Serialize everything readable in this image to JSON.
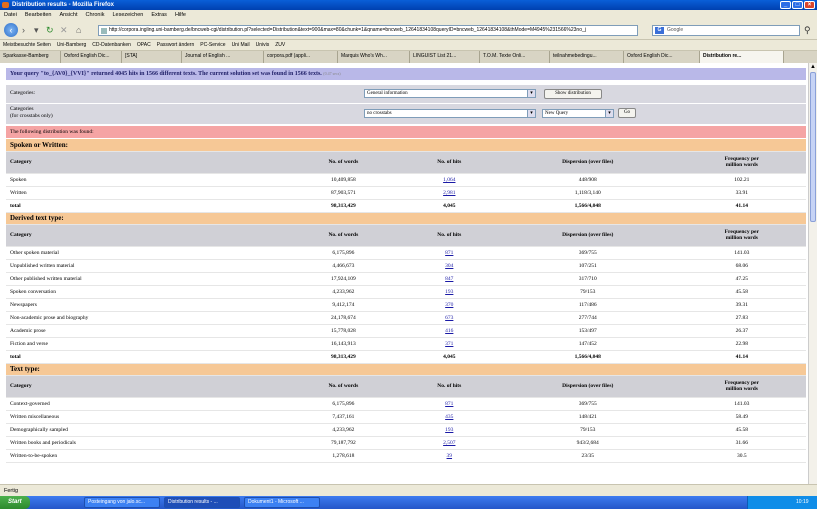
{
  "window": {
    "title": "Distribution results - Mozilla Firefox"
  },
  "menu": [
    "Datei",
    "Bearbeiten",
    "Ansicht",
    "Chronik",
    "Lesezeichen",
    "Extras",
    "Hilfe"
  ],
  "address": {
    "url": "http://corpora.ingling.uni-bamberg.de/bncweb-cgi/distribution.pl?selected=Distribution&text=900&max=80&chunk=1&qname=bncweb_12641834108queryID=bncweb_12641834108&thMode=M4945%231566%23no_j",
    "search_placeholder": "Google"
  },
  "bookmarks": [
    "Meistbesuchte Seiten",
    "Uni-Bamberg",
    "CD-Datenbanken",
    "OPAC",
    "Passwort ändern",
    "PC-Service",
    "Uni Mail",
    "Univis",
    "ZUV"
  ],
  "tabs": [
    {
      "label": "Sparkasse-Bamberg"
    },
    {
      "label": "Oxford English Dic..."
    },
    {
      "label": "[STA]"
    },
    {
      "label": "Journal of English ..."
    },
    {
      "label": "corpora.pdf (appli..."
    },
    {
      "label": "Marquis Who's Wh..."
    },
    {
      "label": "LINGUIST List 21..."
    },
    {
      "label": "T.O.M. Texte Onli..."
    },
    {
      "label": "teilnahmebedingu..."
    },
    {
      "label": "Oxford English Dic..."
    },
    {
      "label": "Distribution re..."
    }
  ],
  "query": {
    "text": "Your query \"to_{AV0}_{VVI}\" returned 4045 hits in 1566 different texts. The current solution set was found in 1566 texts.",
    "time": "(0.47 secs)"
  },
  "controls": {
    "categories_label": "Categories:",
    "categories_value": "General information",
    "show_button": "Show distribution",
    "crosstabs_label": "Categories",
    "crosstabs_sub": "(for crosstabs only)",
    "crosstabs_value": "no crosstabs",
    "action_value": "New Query",
    "go_button": "Go"
  },
  "found": "The following distribution was found:",
  "headers": {
    "category": "Category",
    "words": "No. of words",
    "hits": "No. of hits",
    "dispersion": "Dispersion (over files)",
    "freq1": "Frequency per",
    "freq2": "million words"
  },
  "sections": [
    {
      "title": "Spoken or Written:",
      "rows": [
        {
          "cat": "Spoken",
          "words": "10,409,858",
          "hits": "1,064",
          "disp": "448/908",
          "freq": "102.21"
        },
        {
          "cat": "Written",
          "words": "87,903,571",
          "hits": "2,981",
          "disp": "1,118/3,140",
          "freq": "33.91"
        }
      ],
      "total": {
        "cat": "total",
        "words": "98,313,429",
        "hits": "4,045",
        "disp": "1,566/4,048",
        "freq": "41.14"
      }
    },
    {
      "title": "Derived text type:",
      "rows": [
        {
          "cat": "Other spoken material",
          "words": "6,175,896",
          "hits": "871",
          "disp": "369/755",
          "freq": "141.03"
        },
        {
          "cat": "Unpublished written material",
          "words": "4,466,673",
          "hits": "304",
          "disp": "107/251",
          "freq": "68.06"
        },
        {
          "cat": "Other published written material",
          "words": "17,924,109",
          "hits": "847",
          "disp": "317/710",
          "freq": "47.25"
        },
        {
          "cat": "Spoken conversation",
          "words": "4,233,962",
          "hits": "193",
          "disp": "79/153",
          "freq": "45.58"
        },
        {
          "cat": "Newspapers",
          "words": "9,412,174",
          "hits": "370",
          "disp": "117/486",
          "freq": "39.31"
        },
        {
          "cat": "Non-academic prose and biography",
          "words": "24,178,674",
          "hits": "673",
          "disp": "277/744",
          "freq": "27.83"
        },
        {
          "cat": "Academic prose",
          "words": "15,778,028",
          "hits": "416",
          "disp": "153/497",
          "freq": "26.37"
        },
        {
          "cat": "Fiction and verse",
          "words": "16,143,913",
          "hits": "371",
          "disp": "147/452",
          "freq": "22.98"
        }
      ],
      "total": {
        "cat": "total",
        "words": "98,313,429",
        "hits": "4,045",
        "disp": "1,566/4,048",
        "freq": "41.14"
      }
    },
    {
      "title": "Text type:",
      "rows": [
        {
          "cat": "Context-governed",
          "words": "6,175,896",
          "hits": "871",
          "disp": "369/755",
          "freq": "141.03"
        },
        {
          "cat": "Written miscellaneous",
          "words": "7,437,161",
          "hits": "435",
          "disp": "148/421",
          "freq": "58.49"
        },
        {
          "cat": "Demographically sampled",
          "words": "4,233,962",
          "hits": "193",
          "disp": "79/153",
          "freq": "45.58"
        },
        {
          "cat": "Written books and periodicals",
          "words": "79,187,792",
          "hits": "2,507",
          "disp": "943/2,684",
          "freq": "31.66"
        },
        {
          "cat": "Written-to-be-spoken",
          "words": "1,278,618",
          "hits": "39",
          "disp": "23/35",
          "freq": "30.5"
        }
      ]
    }
  ],
  "status": "Fertig",
  "taskbar": {
    "start": "Start",
    "items": [
      "Posteingang von jalo.sc...",
      "Distribution results - ...",
      "Dokument1 - Microsoft ..."
    ],
    "clock": "10:19"
  }
}
